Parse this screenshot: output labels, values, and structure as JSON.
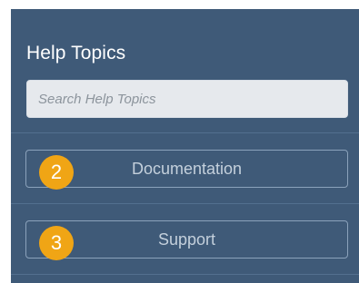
{
  "help_panel": {
    "title": "Help Topics",
    "search": {
      "placeholder": "Search Help Topics",
      "value": ""
    },
    "items": [
      {
        "label": "Documentation",
        "badge": "2"
      },
      {
        "label": "Support",
        "badge": "3"
      }
    ]
  },
  "colors": {
    "panel_background": "#3f5a78",
    "badge": "#f0a515",
    "button_border": "#8ba2bb",
    "button_text": "#c4d0dc"
  },
  "icons": {
    "badges": "numbered-step-badge"
  }
}
